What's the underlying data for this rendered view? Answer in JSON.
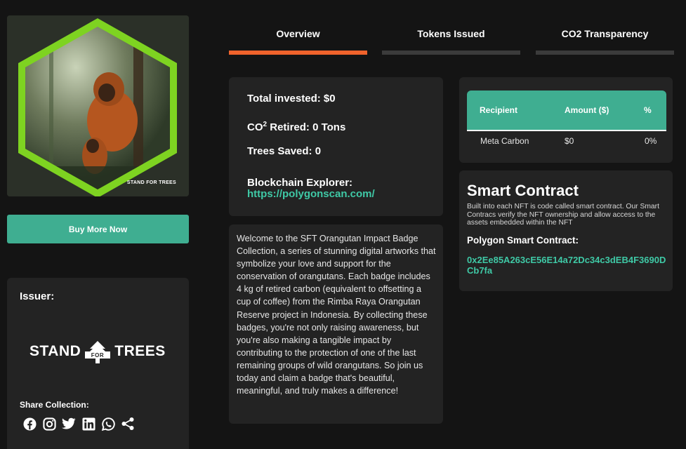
{
  "nft": {
    "brand_mark": "STAND FOR TREES"
  },
  "buy_button": "Buy More Now",
  "issuer": {
    "label": "Issuer:",
    "logo_left": "STAND",
    "logo_mid": "FOR",
    "logo_right": "TREES",
    "share_label": "Share Collection:"
  },
  "socials": [
    "facebook-icon",
    "instagram-icon",
    "twitter-icon",
    "linkedin-icon",
    "whatsapp-icon",
    "share-icon"
  ],
  "tabs": [
    {
      "label": "Overview",
      "active": true
    },
    {
      "label": "Tokens Issued",
      "active": false
    },
    {
      "label": "CO2 Transparency",
      "active": false
    }
  ],
  "stats": {
    "total_invested": "Total invested: $0",
    "co2_prefix": "CO",
    "co2_sup": "2",
    "co2_rest": " Retired: 0 Tons",
    "trees_saved": "Trees Saved: 0",
    "explorer_label": "Blockchain Explorer:",
    "explorer_link": "https://polygonscan.com/"
  },
  "description": "Welcome to the SFT Orangutan Impact Badge Collection, a series of stunning digital artworks that symbolize your love and support for the conservation of orangutans. Each badge includes 4 kg of retired carbon (equivalent to offsetting a cup of coffee) from the Rimba Raya Orangutan Reserve project in Indonesia. By collecting these badges, you're not only raising awareness, but you're also making a tangible impact by contributing to the protection of one of the last remaining groups of wild orangutans. So join us today and claim a badge that's beautiful, meaningful, and truly makes a difference!",
  "recipients": {
    "headers": [
      "Recipient",
      "Amount ($)",
      "%"
    ],
    "rows": [
      [
        "Meta Carbon",
        "$0",
        "0%"
      ]
    ]
  },
  "smart_contract": {
    "title": "Smart Contract",
    "body": "Built into each NFT is code called smart contract. Our Smart Contracs verify the NFT ownership and allow access to the assets embedded within the NFT",
    "address_label": "Polygon Smart Contract:",
    "address": "0x2Ee85A263cE56E14a72Dc34c3dEB4F3690DCb7fa"
  },
  "colors": {
    "accent": "#3fae91",
    "link": "#3fc9a6",
    "tab_active": "#f0632c",
    "card": "#232323",
    "hexagon": "#7ed321"
  }
}
